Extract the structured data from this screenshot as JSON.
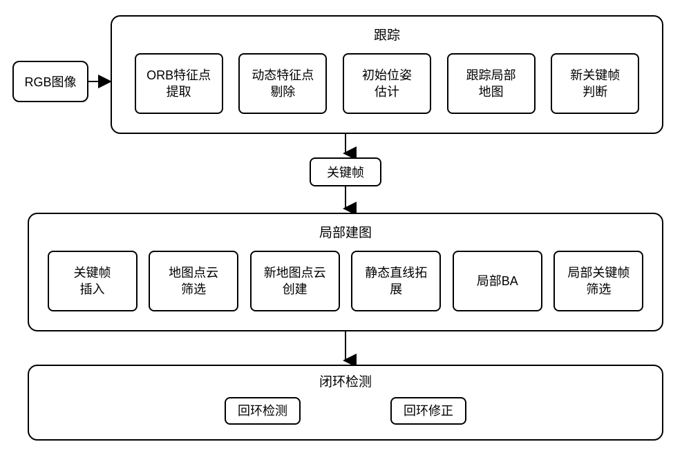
{
  "input": {
    "label": "RGB图像"
  },
  "tracking": {
    "title": "跟踪",
    "steps": [
      "ORB特征点\n提取",
      "动态特征点\n剔除",
      "初始位姿\n估计",
      "跟踪局部\n地图",
      "新关键帧\n判断"
    ]
  },
  "keyframe": {
    "label": "关键帧"
  },
  "mapping": {
    "title": "局部建图",
    "steps": [
      "关键帧\n插入",
      "地图点云\n筛选",
      "新地图点云\n创建",
      "静态直线拓\n展",
      "局部BA",
      "局部关键帧\n筛选"
    ]
  },
  "loop": {
    "title": "闭环检测",
    "steps": [
      "回环检测",
      "回环修正"
    ]
  }
}
